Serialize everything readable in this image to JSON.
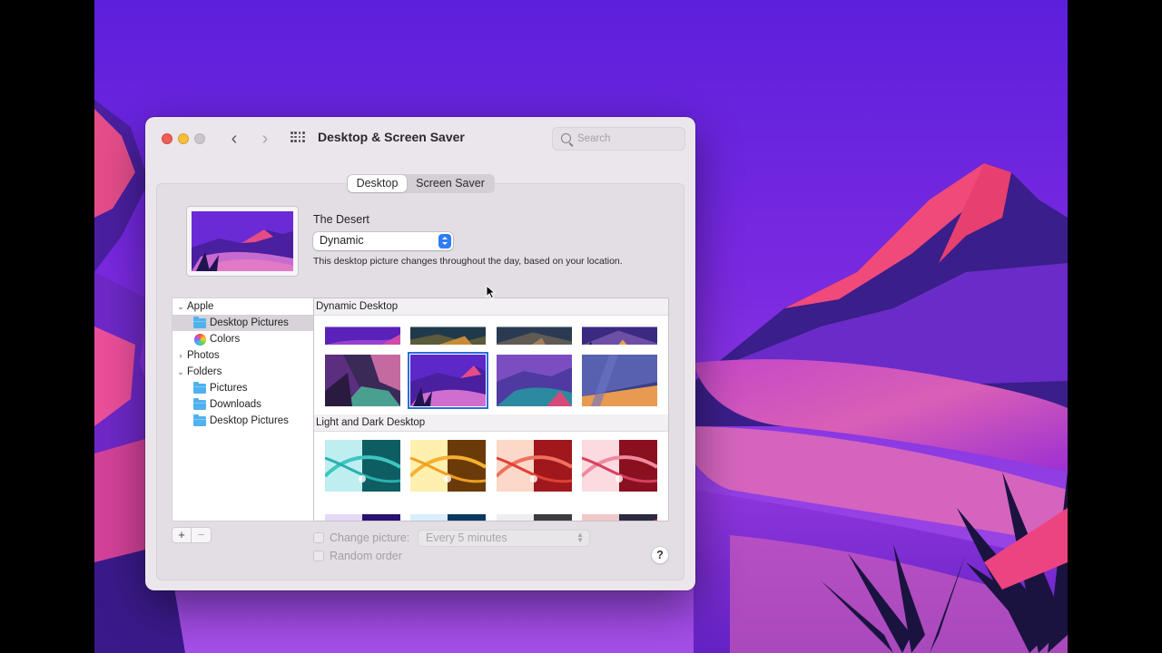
{
  "window": {
    "title": "Desktop & Screen Saver",
    "search": {
      "placeholder": "Search",
      "value": ""
    },
    "tabs": [
      {
        "label": "Desktop",
        "selected": true
      },
      {
        "label": "Screen Saver",
        "selected": false
      }
    ]
  },
  "current": {
    "name": "The Desert",
    "mode": "Dynamic",
    "description": "This desktop picture changes throughout the day, based on your location."
  },
  "sidebar": {
    "groups": [
      {
        "label": "Apple",
        "expanded": true,
        "items": [
          {
            "label": "Desktop Pictures",
            "icon": "folder-icon",
            "selected": true
          },
          {
            "label": "Colors",
            "icon": "colors-icon",
            "selected": false
          }
        ]
      },
      {
        "label": "Photos",
        "expanded": false,
        "items": []
      },
      {
        "label": "Folders",
        "expanded": true,
        "items": [
          {
            "label": "Pictures",
            "icon": "folder-icon"
          },
          {
            "label": "Downloads",
            "icon": "folder-icon"
          },
          {
            "label": "Desktop Pictures",
            "icon": "folder-icon"
          }
        ]
      }
    ],
    "add_label": "+",
    "remove_label": "−"
  },
  "gallery": {
    "sections": [
      {
        "title": "Dynamic Desktop"
      },
      {
        "title": "Light and Dark Desktop"
      }
    ]
  },
  "options": {
    "change_picture_label": "Change picture:",
    "change_picture_checked": false,
    "interval": "Every 5 minutes",
    "random_label": "Random order",
    "random_checked": false
  },
  "help_label": "?",
  "colors": {
    "accent": "#2e7cf6",
    "close": "#ee5d57",
    "minimize": "#f5be3b",
    "selection": "#2d6ce0"
  }
}
